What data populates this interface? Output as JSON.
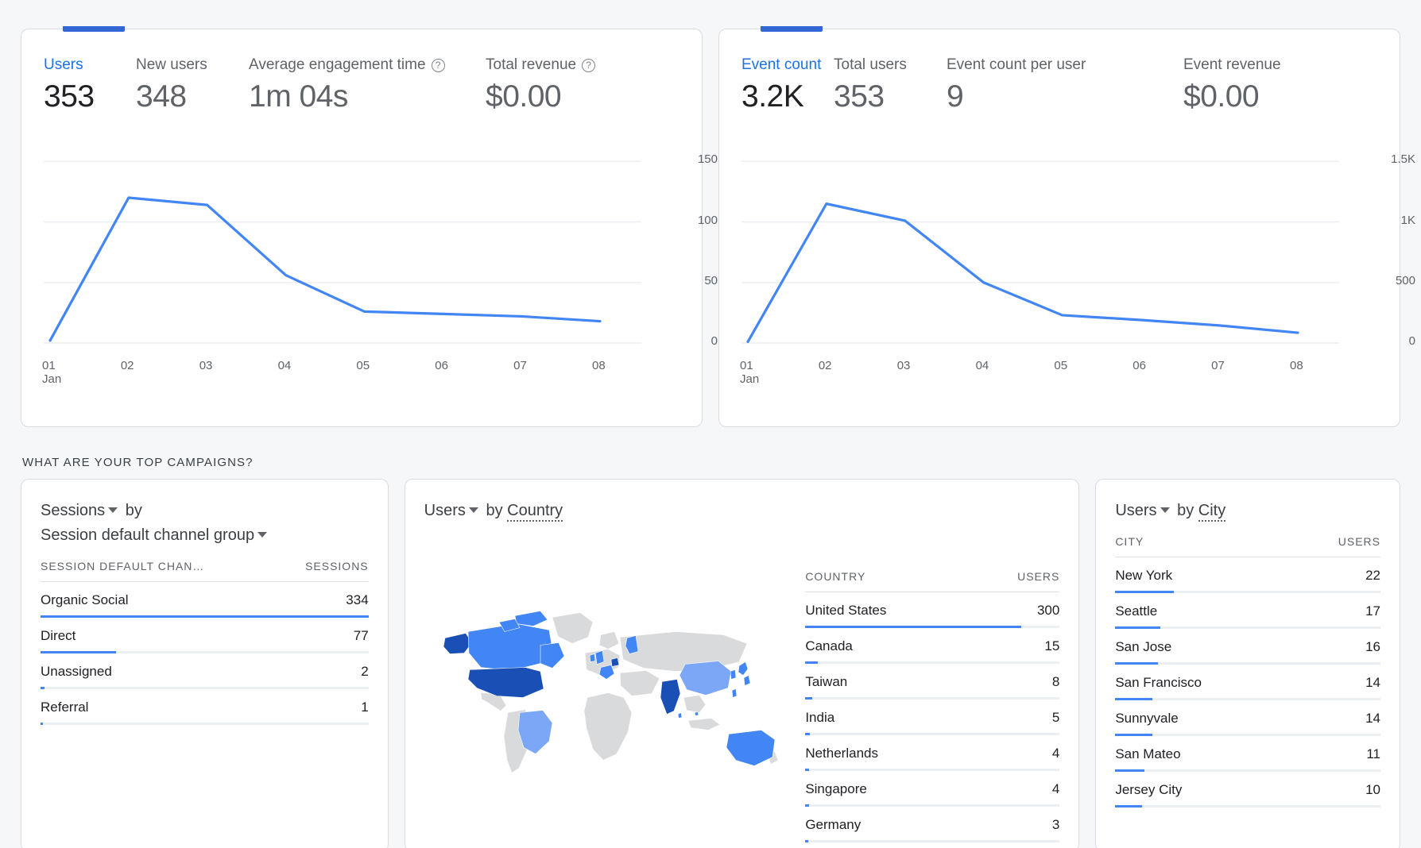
{
  "colors": {
    "accent": "#4285f4",
    "accent_dark": "#1a73e8",
    "tab_indicator": "#3367d6",
    "map_gray": "#d9dadc",
    "map_light": "#7ba7f6",
    "map_mid": "#4285f4",
    "map_dark": "#1a4fb5",
    "text_primary": "#202124",
    "text_secondary": "#5f6368"
  },
  "cards": {
    "users_card": {
      "metrics": [
        {
          "label": "Users",
          "value": "353",
          "active": true,
          "help": false
        },
        {
          "label": "New users",
          "value": "348",
          "active": false,
          "help": false
        },
        {
          "label": "Average engagement time",
          "value": "1m 04s",
          "active": false,
          "help": true
        },
        {
          "label": "Total revenue",
          "value": "$0.00",
          "active": false,
          "help": true
        }
      ]
    },
    "events_card": {
      "metrics": [
        {
          "label": "Event count",
          "value": "3.2K",
          "active": true,
          "help": false
        },
        {
          "label": "Total users",
          "value": "353",
          "active": false,
          "help": false
        },
        {
          "label": "Event count per user",
          "value": "9",
          "active": false,
          "help": false
        },
        {
          "label": "Event revenue",
          "value": "$0.00",
          "active": false,
          "help": false
        }
      ]
    }
  },
  "chart_data": [
    {
      "type": "line",
      "title": "Users",
      "xlabel": "",
      "ylabel": "",
      "x": [
        "01",
        "02",
        "03",
        "04",
        "05",
        "06",
        "07",
        "08"
      ],
      "x_sublabel_first": "Jan",
      "series": [
        {
          "name": "Users",
          "values": [
            2,
            120,
            114,
            56,
            26,
            24,
            22,
            18
          ]
        }
      ],
      "yticks": [
        "150",
        "100",
        "50",
        "0"
      ],
      "ytick_values": [
        150,
        100,
        50,
        0
      ],
      "ylim": [
        0,
        160
      ],
      "grid": true,
      "legend": "none",
      "line_color": "#4285f4"
    },
    {
      "type": "line",
      "title": "Event count",
      "xlabel": "",
      "ylabel": "",
      "x": [
        "01",
        "02",
        "03",
        "04",
        "05",
        "06",
        "07",
        "08"
      ],
      "x_sublabel_first": "Jan",
      "series": [
        {
          "name": "Event count",
          "values": [
            10,
            1150,
            1010,
            500,
            230,
            190,
            145,
            85
          ]
        }
      ],
      "yticks": [
        "1.5K",
        "1K",
        "500",
        "0"
      ],
      "ytick_values": [
        1500,
        1000,
        500,
        0
      ],
      "ylim": [
        0,
        1600
      ],
      "grid": true,
      "legend": "none",
      "line_color": "#4285f4"
    }
  ],
  "section": {
    "title": "WHAT ARE YOUR TOP CAMPAIGNS?"
  },
  "channel_panel": {
    "metric_select": "Sessions",
    "by_label": "by",
    "dimension_select": "Session default channel group",
    "col_dimension": "SESSION DEFAULT CHAN…",
    "col_metric": "SESSIONS",
    "rows": [
      {
        "name": "Organic Social",
        "value": "334",
        "pct": 100
      },
      {
        "name": "Direct",
        "value": "77",
        "pct": 23
      },
      {
        "name": "Unassigned",
        "value": "2",
        "pct": 1.2
      },
      {
        "name": "Referral",
        "value": "1",
        "pct": 0.8
      }
    ]
  },
  "country_panel": {
    "metric_select": "Users",
    "by_label": "by",
    "dimension_select": "Country",
    "col_dimension": "COUNTRY",
    "col_metric": "USERS",
    "rows": [
      {
        "name": "United States",
        "value": "300",
        "pct": 85
      },
      {
        "name": "Canada",
        "value": "15",
        "pct": 5
      },
      {
        "name": "Taiwan",
        "value": "8",
        "pct": 2.8
      },
      {
        "name": "India",
        "value": "5",
        "pct": 1.8
      },
      {
        "name": "Netherlands",
        "value": "4",
        "pct": 1.5
      },
      {
        "name": "Singapore",
        "value": "4",
        "pct": 1.5
      },
      {
        "name": "Germany",
        "value": "3",
        "pct": 1.2
      }
    ]
  },
  "city_panel": {
    "metric_select": "Users",
    "by_label": "by",
    "dimension_select": "City",
    "col_dimension": "CITY",
    "col_metric": "USERS",
    "rows": [
      {
        "name": "New York",
        "value": "22",
        "pct": 22
      },
      {
        "name": "Seattle",
        "value": "17",
        "pct": 17
      },
      {
        "name": "San Jose",
        "value": "16",
        "pct": 16
      },
      {
        "name": "San Francisco",
        "value": "14",
        "pct": 14
      },
      {
        "name": "Sunnyvale",
        "value": "14",
        "pct": 14
      },
      {
        "name": "San Mateo",
        "value": "11",
        "pct": 11
      },
      {
        "name": "Jersey City",
        "value": "10",
        "pct": 10
      }
    ]
  },
  "map": {
    "regions": [
      {
        "name": "United States",
        "shade": "dark"
      },
      {
        "name": "Canada",
        "shade": "mid"
      },
      {
        "name": "Alaska",
        "shade": "dark"
      },
      {
        "name": "Brazil",
        "shade": "light"
      },
      {
        "name": "Australia",
        "shade": "mid"
      },
      {
        "name": "China",
        "shade": "light"
      },
      {
        "name": "India",
        "shade": "dark"
      },
      {
        "name": "Taiwan",
        "shade": "mid"
      },
      {
        "name": "Japan",
        "shade": "mid"
      },
      {
        "name": "Netherlands",
        "shade": "dark"
      },
      {
        "name": "France",
        "shade": "mid"
      },
      {
        "name": "United Kingdom",
        "shade": "mid"
      },
      {
        "name": "Finland",
        "shade": "mid"
      },
      {
        "name": "Singapore",
        "shade": "mid"
      }
    ]
  },
  "icons": {
    "help": "?",
    "caret_down": "chevron-down-icon"
  }
}
